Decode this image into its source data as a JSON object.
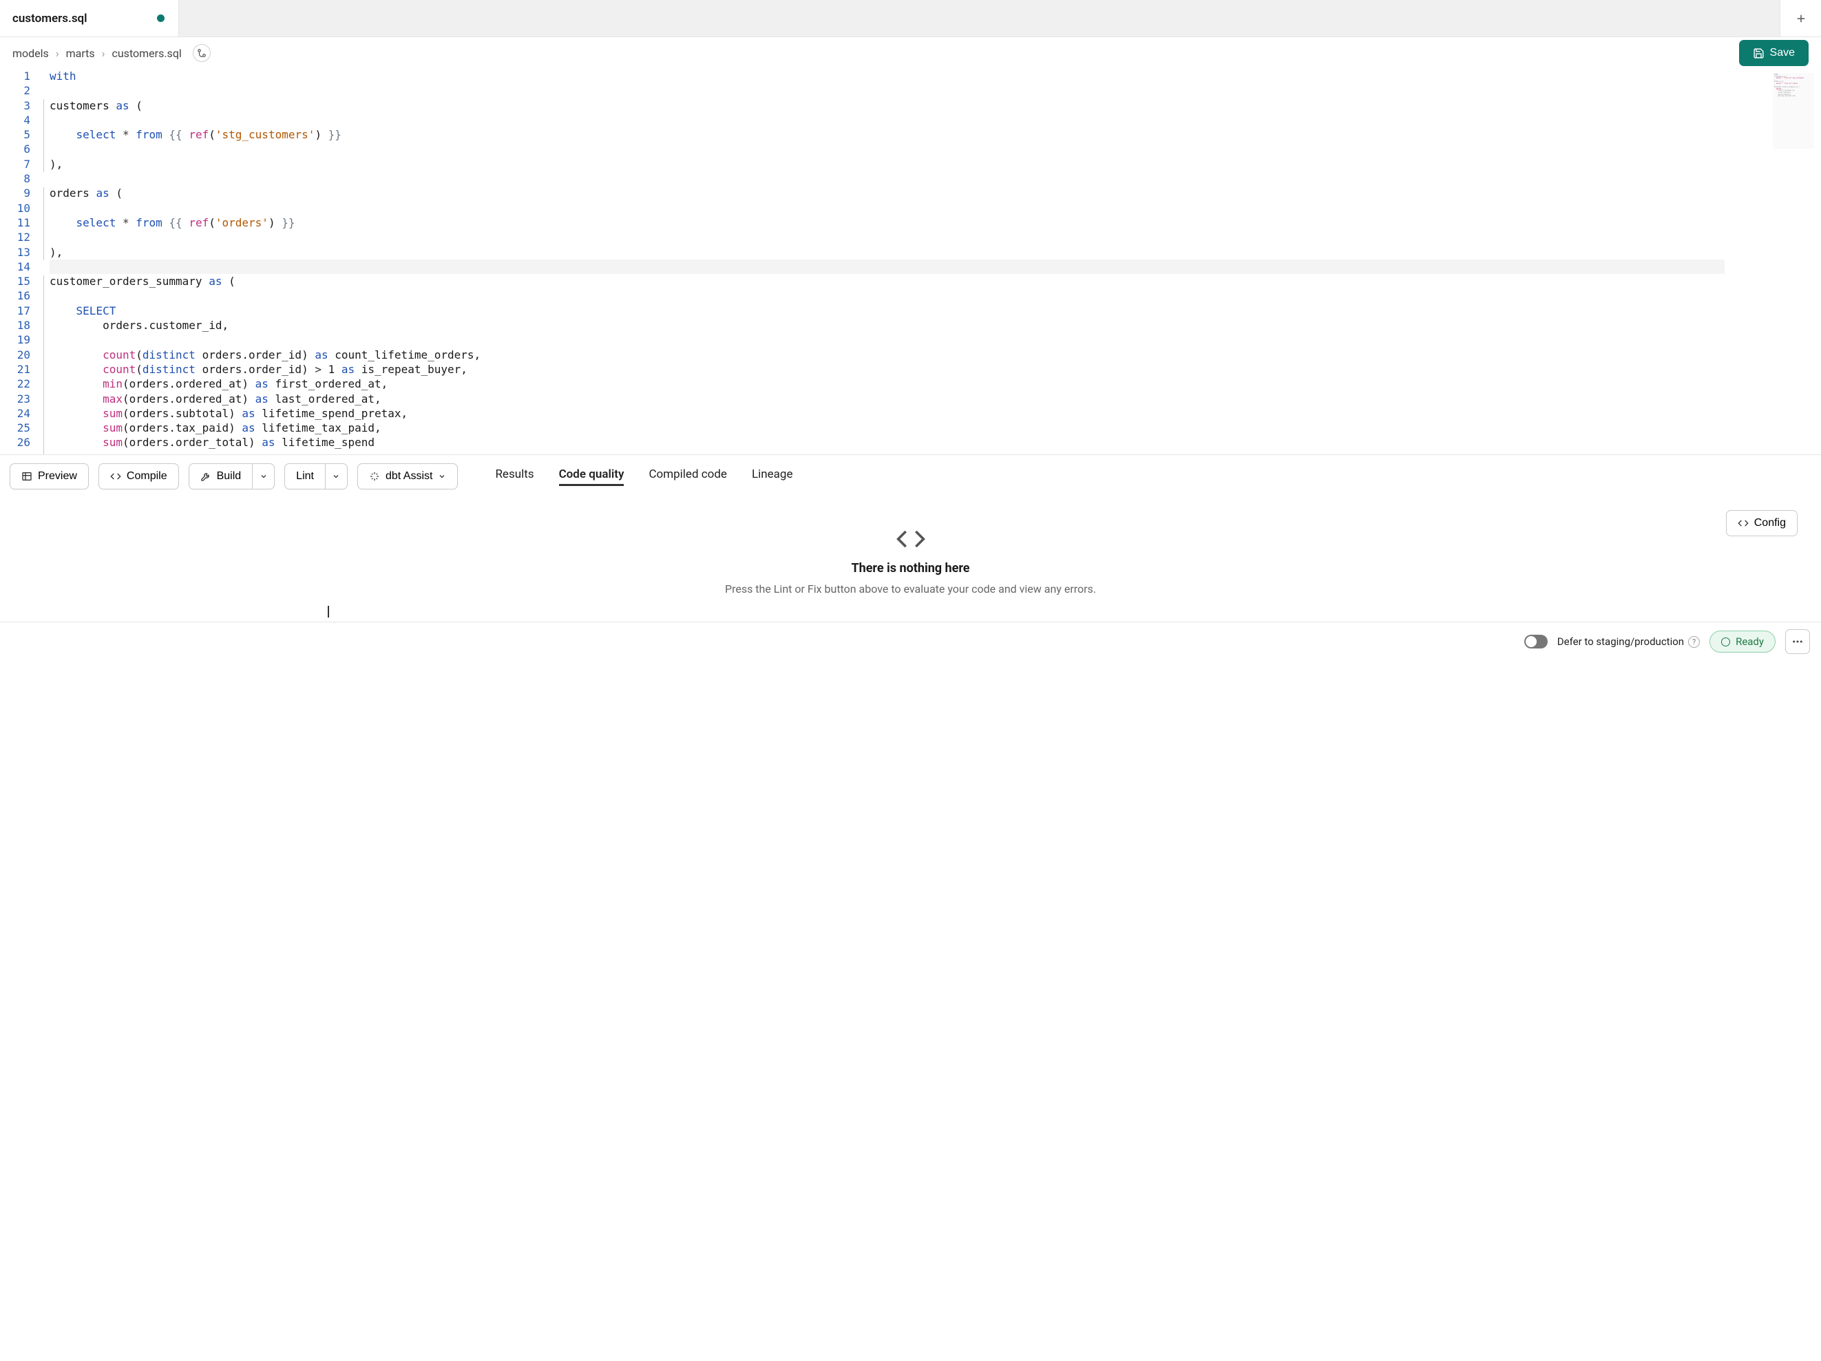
{
  "tab": {
    "title": "customers.sql"
  },
  "breadcrumbs": [
    "models",
    "marts",
    "customers.sql"
  ],
  "save_label": "Save",
  "toolbar": {
    "preview": "Preview",
    "compile": "Compile",
    "build": "Build",
    "lint": "Lint",
    "assist": "dbt Assist"
  },
  "result_tabs": {
    "results": "Results",
    "code_quality": "Code quality",
    "compiled": "Compiled code",
    "lineage": "Lineage"
  },
  "empty": {
    "title": "There is nothing here",
    "subtitle": "Press the Lint or Fix button above to evaluate your code and view any errors."
  },
  "config_label": "Config",
  "status": {
    "defer": "Defer to staging/production",
    "ready": "Ready"
  },
  "code_lines": [
    {
      "n": 1,
      "html": "<span class='kw'>with</span>"
    },
    {
      "n": 2,
      "html": ""
    },
    {
      "n": 3,
      "html": "customers <span class='kw'>as</span> ("
    },
    {
      "n": 4,
      "html": ""
    },
    {
      "n": 5,
      "html": "    <span class='kw'>select</span> <span class='op'>*</span> <span class='kw'>from</span> <span class='tpl'>{{</span> <span class='fn'>ref</span>(<span class='str'>'stg_customers'</span>) <span class='tpl'>}}</span>"
    },
    {
      "n": 6,
      "html": ""
    },
    {
      "n": 7,
      "html": "),"
    },
    {
      "n": 8,
      "html": ""
    },
    {
      "n": 9,
      "html": "orders <span class='kw'>as</span> ("
    },
    {
      "n": 10,
      "html": ""
    },
    {
      "n": 11,
      "html": "    <span class='kw'>select</span> <span class='op'>*</span> <span class='kw'>from</span> <span class='tpl'>{{</span> <span class='fn'>ref</span>(<span class='str'>'orders'</span>) <span class='tpl'>}}</span>"
    },
    {
      "n": 12,
      "html": ""
    },
    {
      "n": 13,
      "html": "),"
    },
    {
      "n": 14,
      "html": ""
    },
    {
      "n": 15,
      "html": "customer_orders_summary <span class='kw'>as</span> ("
    },
    {
      "n": 16,
      "html": ""
    },
    {
      "n": 17,
      "html": "    <span class='kw'>SELECT</span>"
    },
    {
      "n": 18,
      "html": "        orders.customer_id,"
    },
    {
      "n": 19,
      "html": ""
    },
    {
      "n": 20,
      "html": "        <span class='fn'>count</span>(<span class='kw'>distinct</span> orders.order_id) <span class='kw'>as</span> count_lifetime_orders,"
    },
    {
      "n": 21,
      "html": "        <span class='fn'>count</span>(<span class='kw'>distinct</span> orders.order_id) <span class='op'>&gt;</span> 1 <span class='kw'>as</span> is_repeat_buyer,"
    },
    {
      "n": 22,
      "html": "        <span class='fn'>min</span>(orders.ordered_at) <span class='kw'>as</span> first_ordered_at,"
    },
    {
      "n": 23,
      "html": "        <span class='fn'>max</span>(orders.ordered_at) <span class='kw'>as</span> last_ordered_at,"
    },
    {
      "n": 24,
      "html": "        <span class='fn'>sum</span>(orders.subtotal) <span class='kw'>as</span> lifetime_spend_pretax,"
    },
    {
      "n": 25,
      "html": "        <span class='fn'>sum</span>(orders.tax_paid) <span class='kw'>as</span> lifetime_tax_paid,"
    },
    {
      "n": 26,
      "html": "        <span class='fn'>sum</span>(orders.order_total) <span class='kw'>as</span> lifetime_spend"
    }
  ]
}
